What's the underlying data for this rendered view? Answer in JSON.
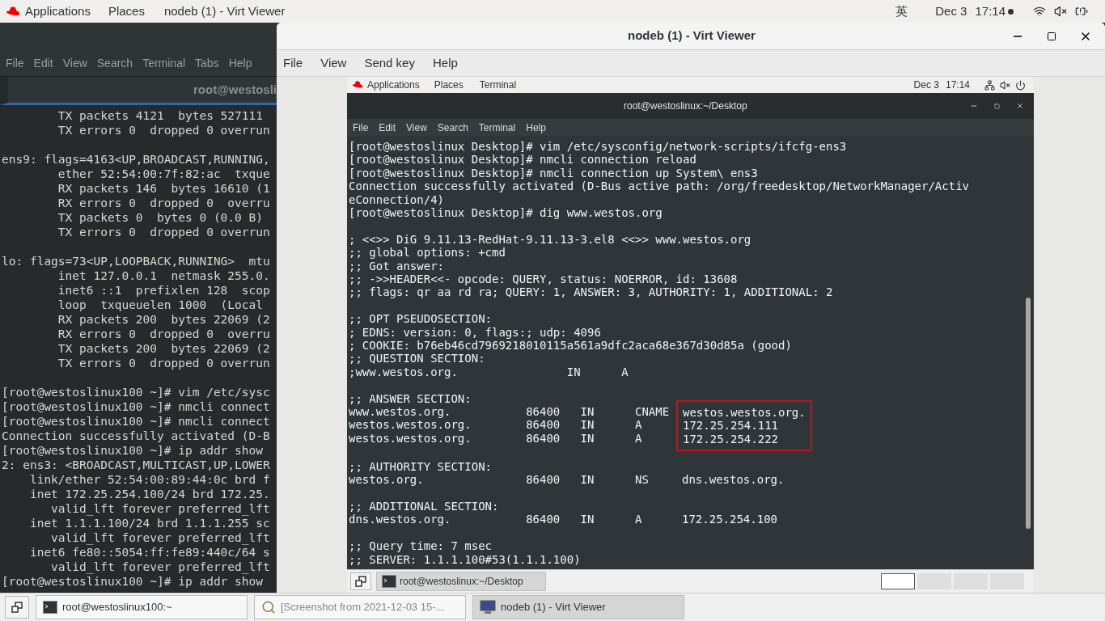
{
  "top_bar": {
    "applications": "Applications",
    "places": "Places",
    "app_name": "nodeb (1) - Virt Viewer",
    "input_method": "英",
    "date": "Dec 3",
    "time": "17:14"
  },
  "left_terminal": {
    "menu": [
      "File",
      "Edit",
      "View",
      "Search",
      "Terminal",
      "Tabs",
      "Help"
    ],
    "tab_title": "root@westosli",
    "paragraphs": [
      [
        "        TX packets 4121  bytes 527111",
        "        TX errors 0  dropped 0 overrun"
      ],
      [
        "ens9: flags=4163<UP,BROADCAST,RUNNING,",
        "        ether 52:54:00:7f:82:ac  txque",
        "        RX packets 146  bytes 16610 (1",
        "        RX errors 0  dropped 0  overru",
        "        TX packets 0  bytes 0 (0.0 B)",
        "        TX errors 0  dropped 0 overrun"
      ],
      [
        "lo: flags=73<UP,LOOPBACK,RUNNING>  mtu",
        "        inet 127.0.0.1  netmask 255.0.",
        "        inet6 ::1  prefixlen 128  scop",
        "        loop  txqueuelen 1000  (Local",
        "        RX packets 200  bytes 22069 (2",
        "        RX errors 0  dropped 0  overru",
        "        TX packets 200  bytes 22069 (2",
        "        TX errors 0  dropped 0 overrun"
      ],
      [
        "[root@westoslinux100 ~]# vim /etc/sysc",
        "[root@westoslinux100 ~]# nmcli connect",
        "[root@westoslinux100 ~]# nmcli connect",
        "Connection successfully activated (D-B",
        "[root@westoslinux100 ~]# ip addr show",
        "2: ens3: <BROADCAST,MULTICAST,UP,LOWER",
        "    link/ether 52:54:00:89:44:0c brd f",
        "    inet 172.25.254.100/24 brd 172.25.",
        "       valid_lft forever preferred_lft",
        "    inet 1.1.1.100/24 brd 1.1.1.255 sc",
        "       valid_lft forever preferred_lft",
        "    inet6 fe80::5054:ff:fe89:440c/64 s",
        "       valid_lft forever preferred_lft",
        "[root@westoslinux100 ~]# ip addr show"
      ]
    ]
  },
  "viewer": {
    "title": "nodeb (1) - Virt Viewer",
    "menu": [
      "File",
      "View",
      "Send key",
      "Help"
    ],
    "guest": {
      "top_bar": {
        "applications": "Applications",
        "places": "Places",
        "terminal": "Terminal",
        "date": "Dec 3",
        "time": "17:14"
      },
      "terminal": {
        "title": "root@westoslinux:~/Desktop",
        "menu": [
          "File",
          "Edit",
          "View",
          "Search",
          "Terminal",
          "Help"
        ],
        "paragraphs": [
          {
            "lines": [
              "[root@westoslinux Desktop]# vim /etc/sysconfig/network-scripts/ifcfg-ens3",
              "[root@westoslinux Desktop]# nmcli connection reload",
              "[root@westoslinux Desktop]# nmcli connection up System\\ ens3",
              "Connection successfully activated (D-Bus active path: /org/freedesktop/NetworkManager/Activ",
              "eConnection/4)",
              "[root@westoslinux Desktop]# dig www.westos.org"
            ]
          },
          {
            "lines": [
              "; <<>> DiG 9.11.13-RedHat-9.11.13-3.el8 <<>> www.westos.org",
              ";; global options: +cmd",
              ";; Got answer:",
              ";; ->>HEADER<<- opcode: QUERY, status: NOERROR, id: 13608",
              ";; flags: qr aa rd ra; QUERY: 1, ANSWER: 3, AUTHORITY: 1, ADDITIONAL: 2"
            ]
          },
          {
            "lines": [
              ";; OPT PSEUDOSECTION:",
              "; EDNS: version: 0, flags:; udp: 4096",
              "; COOKIE: b76eb46cd7969218010115a561a9dfc2aca68e367d30d85a (good)",
              ";; QUESTION SECTION:",
              ";www.westos.org.                IN      A"
            ]
          },
          {
            "lines": [
              ";; ANSWER SECTION:"
            ],
            "records": {
              "highlighted": true,
              "rows": [
                [
                  "www.westos.org.",
                  "86400",
                  "IN",
                  "CNAME",
                  "westos.westos.org."
                ],
                [
                  "westos.westos.org.",
                  "86400",
                  "IN",
                  "A",
                  "172.25.254.111"
                ],
                [
                  "westos.westos.org.",
                  "86400",
                  "IN",
                  "A",
                  "172.25.254.222"
                ]
              ]
            }
          },
          {
            "lines": [
              ";; AUTHORITY SECTION:"
            ],
            "records": {
              "highlighted": false,
              "rows": [
                [
                  "westos.org.",
                  "86400",
                  "IN",
                  "NS",
                  "dns.westos.org."
                ]
              ]
            }
          },
          {
            "lines": [
              ";; ADDITIONAL SECTION:"
            ],
            "records": {
              "highlighted": false,
              "rows": [
                [
                  "dns.westos.org.",
                  "86400",
                  "IN",
                  "A",
                  "172.25.254.100"
                ]
              ]
            }
          },
          {
            "lines": [
              ";; Query time: 7 msec",
              ";; SERVER: 1.1.1.100#53(1.1.1.100)"
            ]
          }
        ]
      },
      "taskbar": {
        "windows": [
          {
            "label": "root@westoslinux:~/Desktop",
            "selected": true
          }
        ],
        "workspaces": [
          {
            "selected": true
          },
          {
            "selected": false
          },
          {
            "selected": false
          },
          {
            "selected": false
          }
        ]
      }
    }
  },
  "taskbar": {
    "windows": [
      {
        "label": "root@westoslinux100:~",
        "kind": "terminal",
        "selected": false
      },
      {
        "label": "[Screenshot from 2021-12-03 15-...",
        "kind": "image",
        "selected": false
      },
      {
        "label": "nodeb (1) - Virt Viewer",
        "kind": "viewer",
        "selected": true
      }
    ]
  }
}
